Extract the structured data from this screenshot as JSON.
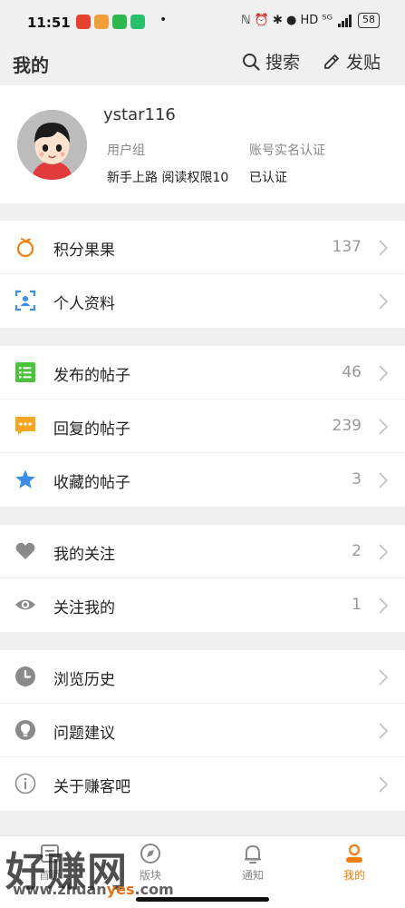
{
  "status_bar": {
    "time": "11:51",
    "more": "•",
    "indicators": "ℕ ⏰ ✱ ● HD ⁵ᴳ",
    "battery": "58"
  },
  "header": {
    "title": "我的",
    "search_label": "搜索",
    "post_label": "发贴"
  },
  "profile": {
    "username": "ystar116",
    "group_label": "用户组",
    "group_value": "新手上路 阅读权限10",
    "auth_label": "账号实名认证",
    "auth_value": "已认证"
  },
  "menu": {
    "points": {
      "label": "积分果果",
      "count": "137",
      "icon": "orange-fruit-icon"
    },
    "profile": {
      "label": "个人资料",
      "icon": "profile-card-icon"
    },
    "posts": {
      "label": "发布的帖子",
      "count": "46",
      "icon": "list-icon"
    },
    "replies": {
      "label": "回复的帖子",
      "count": "239",
      "icon": "chat-bubble-icon"
    },
    "favorites": {
      "label": "收藏的帖子",
      "count": "3",
      "icon": "star-icon"
    },
    "following": {
      "label": "我的关注",
      "count": "2",
      "icon": "heart-icon"
    },
    "followers": {
      "label": "关注我的",
      "count": "1",
      "icon": "eye-icon"
    },
    "history": {
      "label": "浏览历史",
      "icon": "clock-icon"
    },
    "feedback": {
      "label": "问题建议",
      "icon": "lightbulb-icon"
    },
    "about": {
      "label": "关于赚客吧",
      "icon": "info-icon"
    }
  },
  "tabbar": {
    "home": "首页",
    "discover": "版块",
    "notice": "通知",
    "mine": "我的"
  },
  "watermark": {
    "text": "好赚网",
    "url_prefix": "www.zhuan",
    "url_highlight": "yes",
    "url_suffix": ".com"
  },
  "colors": {
    "accent": "#f27d0c",
    "icon_blue": "#3a8ee6",
    "icon_green": "#4cc23a",
    "icon_yellow": "#f5a623",
    "icon_gray": "#8a8a8a"
  }
}
